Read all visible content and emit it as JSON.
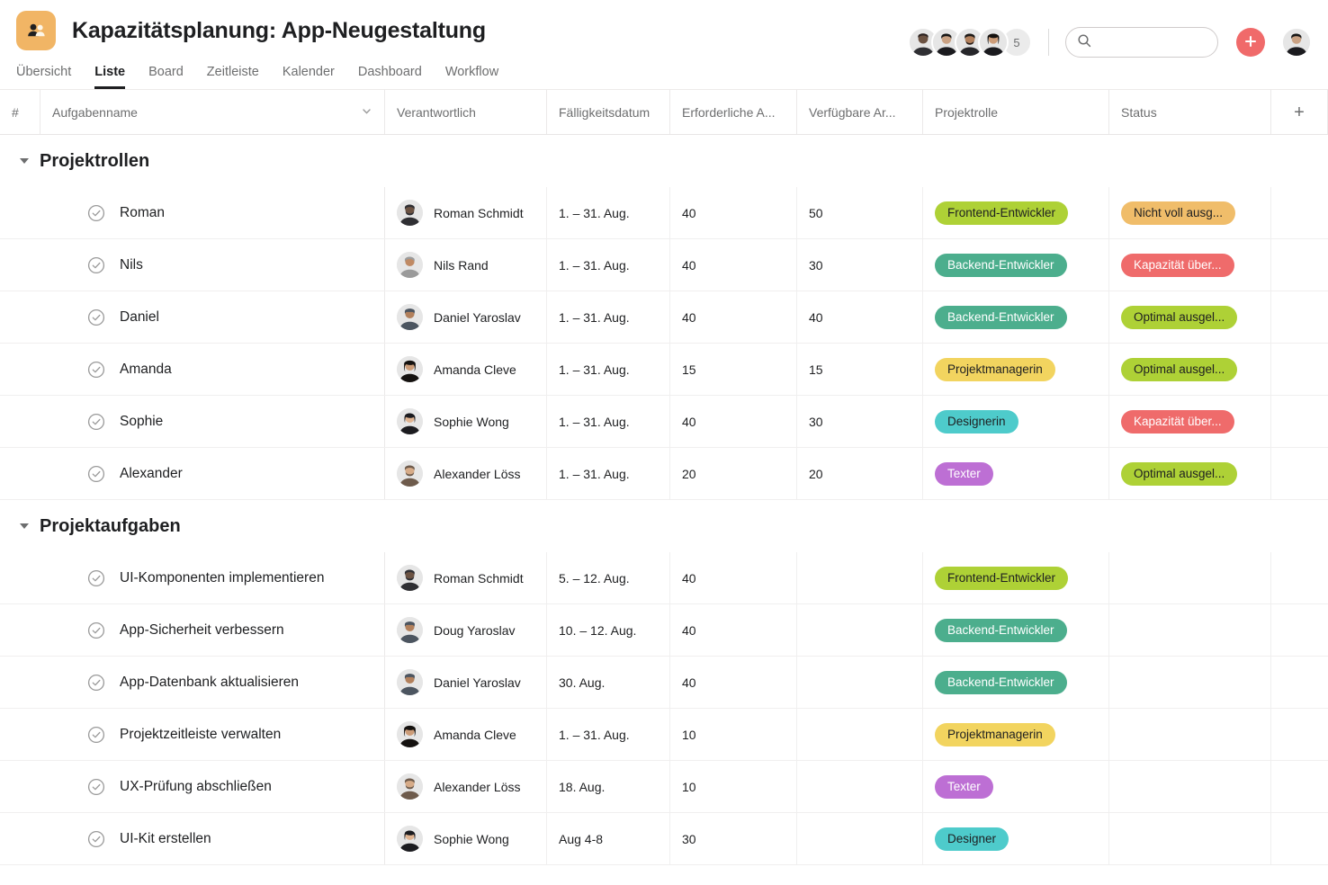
{
  "header": {
    "app_icon": "people-icon",
    "title": "Kapazitätsplanung: App-Neugestaltung",
    "member_overflow_count": "5",
    "search_placeholder": "",
    "search_value": "",
    "search_icon": "search-icon",
    "add_button_icon": "plus-icon",
    "add_button_label": "+",
    "accent_color": "#f06a6a",
    "icon_bg_color": "#f1b565"
  },
  "tabs": [
    {
      "label": "Übersicht",
      "active": false
    },
    {
      "label": "Liste",
      "active": true
    },
    {
      "label": "Board",
      "active": false
    },
    {
      "label": "Zeitleiste",
      "active": false
    },
    {
      "label": "Kalender",
      "active": false
    },
    {
      "label": "Dashboard",
      "active": false
    },
    {
      "label": "Workflow",
      "active": false
    }
  ],
  "table": {
    "columns": [
      {
        "key": "num",
        "label": "#"
      },
      {
        "key": "name",
        "label": "Aufgabenname"
      },
      {
        "key": "owner",
        "label": "Verantwortlich"
      },
      {
        "key": "date",
        "label": "Fälligkeitsdatum"
      },
      {
        "key": "req",
        "label": "Erforderliche A..."
      },
      {
        "key": "avail",
        "label": "Verfügbare Ar..."
      },
      {
        "key": "role",
        "label": "Projektrolle"
      },
      {
        "key": "status",
        "label": "Status"
      },
      {
        "key": "add",
        "label": "+"
      }
    ],
    "groups": [
      {
        "title": "Projektrollen",
        "expanded": true,
        "rows": [
          {
            "name": "Roman",
            "owner": "Roman Schmidt",
            "date": "1. – 31. Aug.",
            "required": "40",
            "available": "50",
            "role": {
              "label": "Frontend-Entwickler",
              "bg": "#aed136",
              "fg": "#1e1f21"
            },
            "status": {
              "label": "Nicht voll ausg...",
              "bg": "#f0bd6a",
              "fg": "#1e1f21"
            }
          },
          {
            "name": "Nils",
            "owner": "Nils Rand",
            "date": "1. – 31. Aug.",
            "required": "40",
            "available": "30",
            "role": {
              "label": "Backend-Entwickler",
              "bg": "#4cae8d",
              "fg": "#ffffff"
            },
            "status": {
              "label": "Kapazität über...",
              "bg": "#ef6b6b",
              "fg": "#ffffff"
            }
          },
          {
            "name": "Daniel",
            "owner": "Daniel Yaroslav",
            "date": "1. – 31. Aug.",
            "required": "40",
            "available": "40",
            "role": {
              "label": "Backend-Entwickler",
              "bg": "#4cae8d",
              "fg": "#ffffff"
            },
            "status": {
              "label": "Optimal ausgel...",
              "bg": "#aed136",
              "fg": "#1e1f21"
            }
          },
          {
            "name": "Amanda",
            "owner": "Amanda Cleve",
            "date": "1. – 31. Aug.",
            "required": "15",
            "available": "15",
            "role": {
              "label": "Projektmanagerin",
              "bg": "#f2d45f",
              "fg": "#1e1f21"
            },
            "status": {
              "label": "Optimal ausgel...",
              "bg": "#aed136",
              "fg": "#1e1f21"
            }
          },
          {
            "name": "Sophie",
            "owner": "Sophie Wong",
            "date": "1. – 31. Aug.",
            "required": "40",
            "available": "30",
            "role": {
              "label": "Designerin",
              "bg": "#4ecbcb",
              "fg": "#1e1f21"
            },
            "status": {
              "label": "Kapazität über...",
              "bg": "#ef6b6b",
              "fg": "#ffffff"
            }
          },
          {
            "name": "Alexander",
            "owner": "Alexander Löss",
            "date": "1. – 31. Aug.",
            "required": "20",
            "available": "20",
            "role": {
              "label": "Texter",
              "bg": "#bd6fd4",
              "fg": "#ffffff"
            },
            "status": {
              "label": "Optimal ausgel...",
              "bg": "#aed136",
              "fg": "#1e1f21"
            }
          }
        ]
      },
      {
        "title": "Projektaufgaben",
        "expanded": true,
        "rows": [
          {
            "name": "UI-Komponenten implementieren",
            "owner": "Roman Schmidt",
            "date": "5. – 12. Aug.",
            "required": "40",
            "available": "",
            "role": {
              "label": "Frontend-Entwickler",
              "bg": "#aed136",
              "fg": "#1e1f21"
            },
            "status": null
          },
          {
            "name": "App-Sicherheit verbessern",
            "owner": "Doug Yaroslav",
            "date": "10. – 12. Aug.",
            "required": "40",
            "available": "",
            "role": {
              "label": "Backend-Entwickler",
              "bg": "#4cae8d",
              "fg": "#ffffff"
            },
            "status": null
          },
          {
            "name": "App-Datenbank aktualisieren",
            "owner": "Daniel Yaroslav",
            "date": "30. Aug.",
            "required": "40",
            "available": "",
            "role": {
              "label": "Backend-Entwickler",
              "bg": "#4cae8d",
              "fg": "#ffffff"
            },
            "status": null
          },
          {
            "name": "Projektzeitleiste verwalten",
            "owner": "Amanda Cleve",
            "date": "1. – 31. Aug.",
            "required": "10",
            "available": "",
            "role": {
              "label": "Projektmanagerin",
              "bg": "#f2d45f",
              "fg": "#1e1f21"
            },
            "status": null
          },
          {
            "name": "UX-Prüfung abschließen",
            "owner": "Alexander Löss",
            "date": "18. Aug.",
            "required": "10",
            "available": "",
            "role": {
              "label": "Texter",
              "bg": "#bd6fd4",
              "fg": "#ffffff"
            },
            "status": null
          },
          {
            "name": "UI-Kit erstellen",
            "owner": "Sophie Wong",
            "date": "Aug 4-8",
            "required": "30",
            "available": "",
            "role": {
              "label": "Designer",
              "bg": "#4ecbcb",
              "fg": "#1e1f21"
            },
            "status": null
          }
        ]
      }
    ]
  }
}
